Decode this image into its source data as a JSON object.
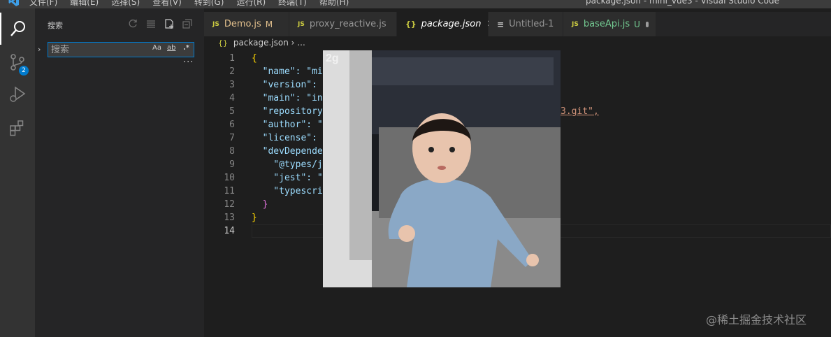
{
  "titlebar": {
    "menus": [
      "文件(F)",
      "编辑(E)",
      "选择(S)",
      "查看(V)",
      "转到(G)",
      "运行(R)",
      "终端(T)",
      "帮助(H)"
    ],
    "window_title": "package.json - mini_vue3 - Visual Studio Code"
  },
  "activitybar": {
    "items": [
      "search-icon",
      "source-control-icon",
      "run-debug-icon",
      "extensions-icon"
    ],
    "source_control_badge": "2"
  },
  "sidebar": {
    "title": "搜索",
    "tools": [
      "refresh-icon",
      "clear-results-icon",
      "new-search-editor-icon",
      "collapse-all-icon"
    ],
    "search": {
      "placeholder": "搜索",
      "value": "",
      "options": [
        "Aa",
        "ab",
        ".*"
      ]
    },
    "more": "···"
  },
  "tabs": [
    {
      "icon": "JS",
      "label": "Demo.js",
      "status": "M",
      "status_color": "#e2c08d",
      "label_color": "#e2c08d"
    },
    {
      "icon": "JS",
      "label": "proxy_reactive.js",
      "status": "dot",
      "label_color": "#cccccc"
    },
    {
      "icon": "{}",
      "label": "package.json",
      "status": "close",
      "active": true,
      "label_color": "#ffffff"
    },
    {
      "icon": "≡",
      "label": "Untitled-1",
      "status": "",
      "label_color": "#cccccc"
    },
    {
      "icon": "JS",
      "label": "baseApi.js",
      "status": "U",
      "status_color": "#73c991",
      "label_color": "#73c991"
    }
  ],
  "breadcrumb": {
    "file": "package.json",
    "separator": "›",
    "ellipsis": "..."
  },
  "editor": {
    "current_line": 14,
    "lines": [
      {
        "n": "1",
        "text": "{"
      },
      {
        "n": "2",
        "text": "  \"name\": \"mi"
      },
      {
        "n": "3",
        "text": "  \"version\":"
      },
      {
        "n": "4",
        "text": "  \"main\": \"in"
      },
      {
        "n": "5",
        "text": "  \"repository",
        "tail": "3.git\","
      },
      {
        "n": "6",
        "text": "  \"author\": \""
      },
      {
        "n": "7",
        "text": "  \"license\":"
      },
      {
        "n": "8",
        "text": "  \"devDepender"
      },
      {
        "n": "9",
        "text": "    \"@types/j"
      },
      {
        "n": "10",
        "text": "    \"jest\": \""
      },
      {
        "n": "11",
        "text": "    \"typescrip"
      },
      {
        "n": "12",
        "text": "  }"
      },
      {
        "n": "13",
        "text": "}"
      },
      {
        "n": "14",
        "text": ""
      }
    ]
  },
  "overlay": {
    "corner_text": "2g"
  },
  "watermark": "@稀土掘金技术社区",
  "colors": {
    "accent": "#007acc",
    "editor_bg": "#1e1e1e",
    "sidebar_bg": "#252526",
    "activity_bg": "#333333",
    "json_key": "#9cdcfe",
    "json_string": "#ce9178"
  }
}
